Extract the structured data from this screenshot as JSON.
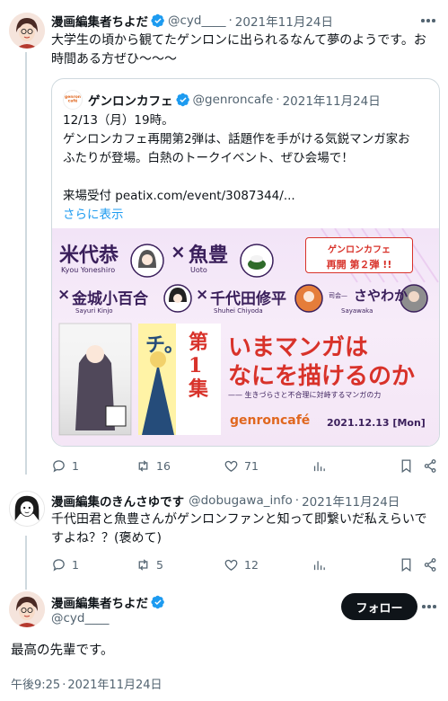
{
  "tweet1": {
    "author_name": "漫画編集者ちよだ",
    "handle": "@cyd____",
    "separator": "·",
    "date": "2021年11月24日",
    "text": "大学生の頃から観てたゲンロンに出られるなんて夢のようです。お時間ある方ぜひ〜〜〜",
    "quote": {
      "author_name": "ゲンロンカフェ",
      "handle": "@genroncafe",
      "separator": "·",
      "date": "2021年11月24日",
      "lines": [
        "12/13（月）19時。",
        "ゲンロンカフェ再開第2弾は、話題作を手がける気鋭マンガ家お",
        "ふたりが登場。白熱のトークイベント、ぜひ会場で！",
        "",
        "来場受付 peatix.com/event/3087344/..."
      ],
      "more_label": "さらに表示",
      "avatar_text": "genron café",
      "banner": {
        "artist1": "米代恭",
        "artist1_romaji": "Kyou Yoneshiro",
        "times1": "×",
        "artist2": "魚豊",
        "artist2_romaji": "Uoto",
        "badge_line1": "ゲンロンカフェ",
        "badge_line2": "再開 第２弾 !!",
        "times2": "×",
        "artist3": "金城小百合",
        "artist3_romaji": "Sayuri Kinjo",
        "times3": "×",
        "artist4": "千代田修平",
        "artist4_romaji": "Shuhei Chiyoda",
        "moderator_prefix": "司会—",
        "moderator": "さやわか",
        "moderator_romaji": "Sayawaka",
        "book2_title": "チ。",
        "book2_volume": "第1集",
        "headline1": "いまマンガは",
        "headline2": "なにを描けるのか",
        "subtitle": "—— 生きづらさと不合理に対峙するマンガの力",
        "logo": "genroncafé",
        "event_date": "2021.12.13 [Mon]"
      }
    },
    "actions": {
      "replies": "1",
      "retweets": "16",
      "likes": "71"
    }
  },
  "tweet2": {
    "author_name": "漫画編集のきんさゆです",
    "handle": "@dobugawa_info",
    "separator": "·",
    "date": "2021年11月24日",
    "text": "千代田君と魚豊さんがゲンロンファンと知って即繋いだ私えらいですよね？？(褒めて)",
    "actions": {
      "replies": "1",
      "retweets": "5",
      "likes": "12"
    }
  },
  "tweet3": {
    "author_name": "漫画編集者ちよだ",
    "handle": "@cyd____",
    "follow_label": "フォロー",
    "text": "最高の先輩です。",
    "time": "午後9:25",
    "separator": "·",
    "date": "2021年11月24日"
  },
  "colors": {
    "verified": "#1d9bf0",
    "link": "#1d9bf0",
    "secondary_text": "#536471",
    "banner_red": "#d8322a",
    "banner_purple": "#3a1f5b",
    "follow_button": "#0f1419"
  }
}
